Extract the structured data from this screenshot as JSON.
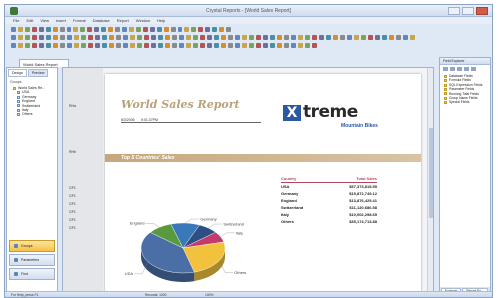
{
  "window": {
    "title": "Crystal Reports - [World Sales Report]",
    "menu": [
      "File",
      "Edit",
      "View",
      "Insert",
      "Format",
      "Database",
      "Report",
      "Window",
      "Help"
    ]
  },
  "tabs": {
    "document": "World Sales Report"
  },
  "left_panel": {
    "tabs": [
      "Design",
      "Preview"
    ],
    "group_label": "Groups",
    "tree": [
      {
        "label": "World Sales Re...",
        "sub": false
      },
      {
        "label": "USA",
        "sub": true
      },
      {
        "label": "Germany",
        "sub": true
      },
      {
        "label": "England",
        "sub": true
      },
      {
        "label": "Switzerland",
        "sub": true
      },
      {
        "label": "Italy",
        "sub": true
      },
      {
        "label": "Others",
        "sub": true
      }
    ],
    "buttons": [
      "Groups",
      "Parameters",
      "Find"
    ]
  },
  "report": {
    "title": "World Sales Report",
    "date": "8/3/2006",
    "time": "5:01:37PM",
    "logo": {
      "mark": "X",
      "word": "treme",
      "sub": "Mountain Bikes"
    },
    "band": "Top 5 Countries' Sales",
    "sections": [
      "RHa",
      "RHb",
      "GF1",
      "GF1",
      "GF1",
      "GF1",
      "GF1",
      "GF1"
    ],
    "table": {
      "headers": [
        "Country",
        "Total Sales"
      ],
      "rows": [
        [
          "USA",
          "$57,373,815.59"
        ],
        [
          "Germany",
          "$15,872,749.12"
        ],
        [
          "England",
          "$13,876,425.41"
        ],
        [
          "Switzerland",
          "$11,120,686.58"
        ],
        [
          "Italy",
          "$10,002,298.65"
        ],
        [
          "Others",
          "$35,174,713.88"
        ]
      ]
    }
  },
  "chart_data": {
    "type": "pie",
    "categories": [
      "England",
      "Germany",
      "Switzerland",
      "Italy",
      "Others",
      "USA"
    ],
    "values": [
      13876425.41,
      15872749.12,
      11120686.58,
      10002298.65,
      35174713.88,
      57373815.59
    ],
    "colors": [
      "#5a9a3f",
      "#3a78b8",
      "#2d4f84",
      "#c23b6b",
      "#f2c23f",
      "#4a6ea6"
    ]
  },
  "right_panel": {
    "header": "Field Explorer",
    "tree": [
      {
        "label": "Database Fields",
        "sub": false
      },
      {
        "label": "Formula Fields",
        "sub": false
      },
      {
        "label": "SQL Expression Fields",
        "sub": false
      },
      {
        "label": "Parameter Fields",
        "sub": false
      },
      {
        "label": "Running Total Fields",
        "sub": false
      },
      {
        "label": "Group Name Fields",
        "sub": false
      },
      {
        "label": "Special Fields",
        "sub": false
      }
    ],
    "tabs": [
      "Explorer",
      "Report Ex..."
    ]
  },
  "status": {
    "left": "For Help, press F1",
    "mid": "Records: 1000",
    "right": "100%"
  }
}
